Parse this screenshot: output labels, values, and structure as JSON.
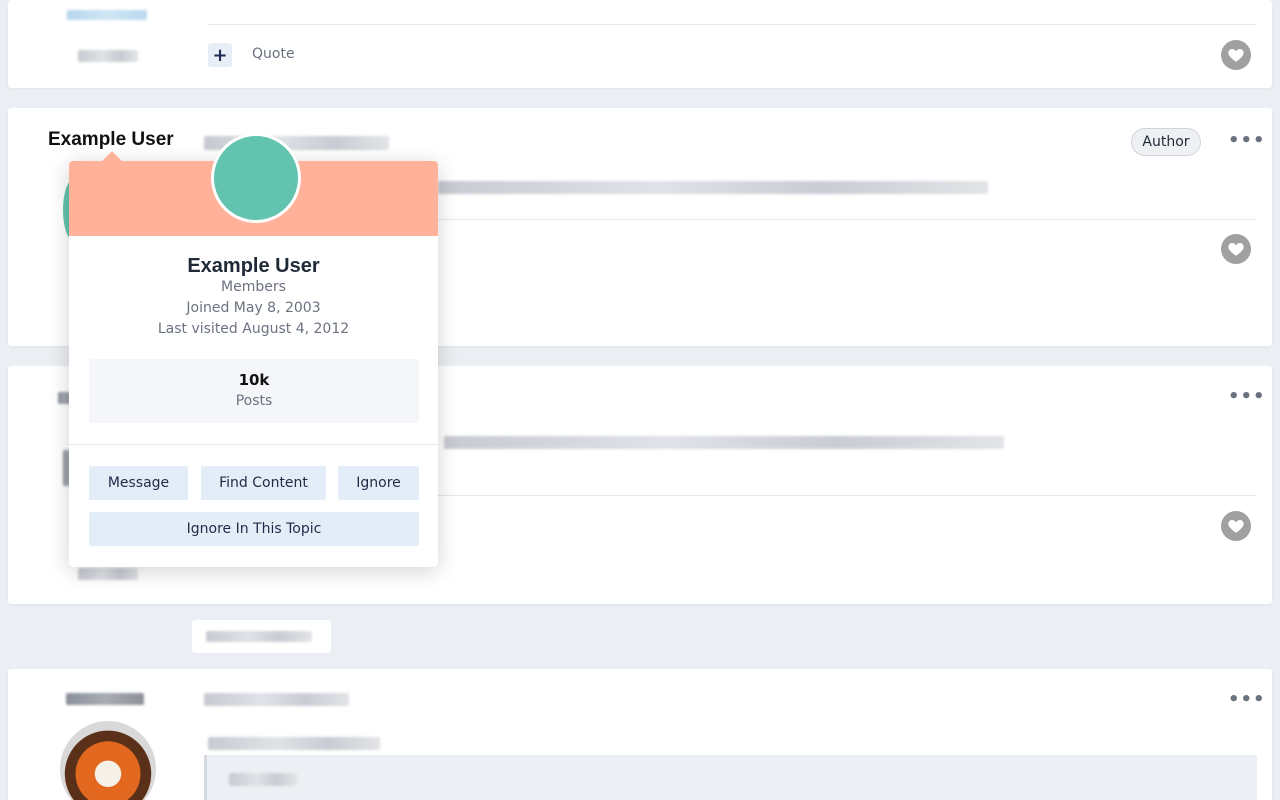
{
  "post_actions": {
    "quote_label": "Quote"
  },
  "post2": {
    "username": "Example User",
    "author_badge": "Author"
  },
  "hovercard": {
    "name": "Example User",
    "group": "Members",
    "joined": "Joined May 8, 2003",
    "last_visited": "Last visited August 4, 2012",
    "stat_value": "10k",
    "stat_label": "Posts",
    "buttons": {
      "message": "Message",
      "find_content": "Find Content",
      "ignore": "Ignore",
      "ignore_topic": "Ignore In This Topic"
    }
  },
  "icons": {
    "heart": "heart-icon",
    "more": "more-options-icon",
    "plus": "plus-icon"
  },
  "colors": {
    "banner": "#ffb199",
    "avatar": "#62c4ae",
    "button_bg": "#e3edf8"
  }
}
